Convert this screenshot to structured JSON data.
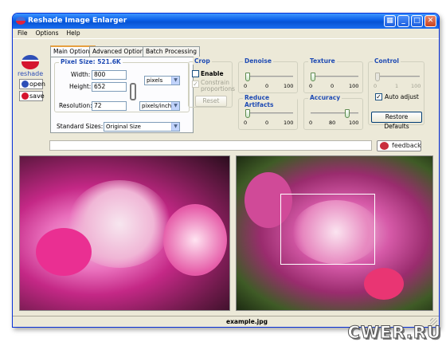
{
  "window": {
    "title": "Reshade Image Enlarger"
  },
  "titlebar_buttons": [
    "grid-icon",
    "minimize-icon",
    "maximize-icon",
    "close-icon"
  ],
  "menu": [
    "File",
    "Options",
    "Help"
  ],
  "sidebar": {
    "logo_text": "reshade",
    "open": "open",
    "save": "save"
  },
  "tabs": [
    "Main Options",
    "Advanced Options",
    "Batch Processing"
  ],
  "main": {
    "pixel_size_label": "Pixel Size: 521.6K",
    "width_label": "Width:",
    "width": "800",
    "height_label": "Height:",
    "height": "652",
    "units": "pixels",
    "resolution_label": "Resolution:",
    "resolution": "72",
    "res_units": "pixels/inch",
    "standard_sizes_label": "Standard Sizes:",
    "standard_sizes": "Original Size"
  },
  "crop": {
    "title": "Crop",
    "enable": "Enable",
    "constrain": "Constrain proportions",
    "reset": "Reset"
  },
  "denoise": {
    "title": "Denoise",
    "ticks": [
      "0",
      "0",
      "100"
    ],
    "value": 0
  },
  "texture": {
    "title": "Texture",
    "ticks": [
      "0",
      "0",
      "100"
    ],
    "value": 0
  },
  "control": {
    "title": "Control",
    "ticks": [
      "0",
      "1",
      "100"
    ],
    "auto_adjust": "Auto adjust",
    "restore": "Restore Defaults"
  },
  "reduce": {
    "title": "Reduce Artifacts",
    "ticks": [
      "0",
      "0",
      "100"
    ],
    "value": 0
  },
  "accuracy": {
    "title": "Accuracy",
    "ticks": [
      "0",
      "80",
      "100"
    ],
    "value": 80
  },
  "feedback": "feedback",
  "status": {
    "filename": "example.jpg"
  },
  "watermark": "CWER.RU",
  "colors": {
    "accent": "#1f4bb4",
    "title_bar": "#0a5ee7"
  }
}
